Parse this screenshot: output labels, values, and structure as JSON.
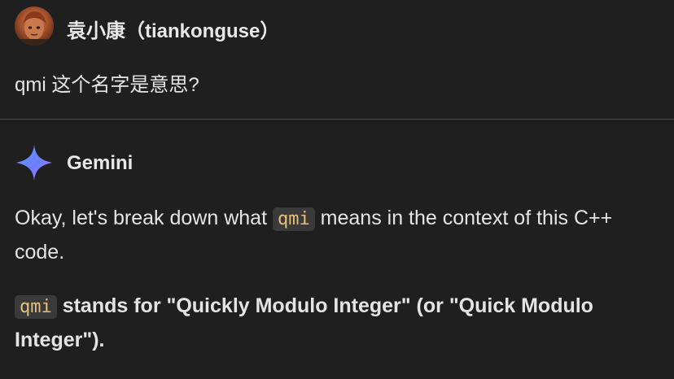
{
  "user": {
    "name": "袁小康（tiankonguse）",
    "message": "qmi 这个名字是意思?"
  },
  "model": {
    "name": "Gemini",
    "para1": {
      "before": "Okay, let's break down what ",
      "code": "qmi",
      "after": " means in the context of this C++ code."
    },
    "para2": {
      "code": "qmi",
      "after": " stands for \"Quickly Modulo Integer\" (or \"Quick Modulo Integer\")."
    }
  },
  "colors": {
    "background": "#1f1f1f",
    "text": "#e4e4e4",
    "code_text": "#e6c07b",
    "code_bg": "#3a3a3a",
    "divider": "#4a4a4a"
  }
}
